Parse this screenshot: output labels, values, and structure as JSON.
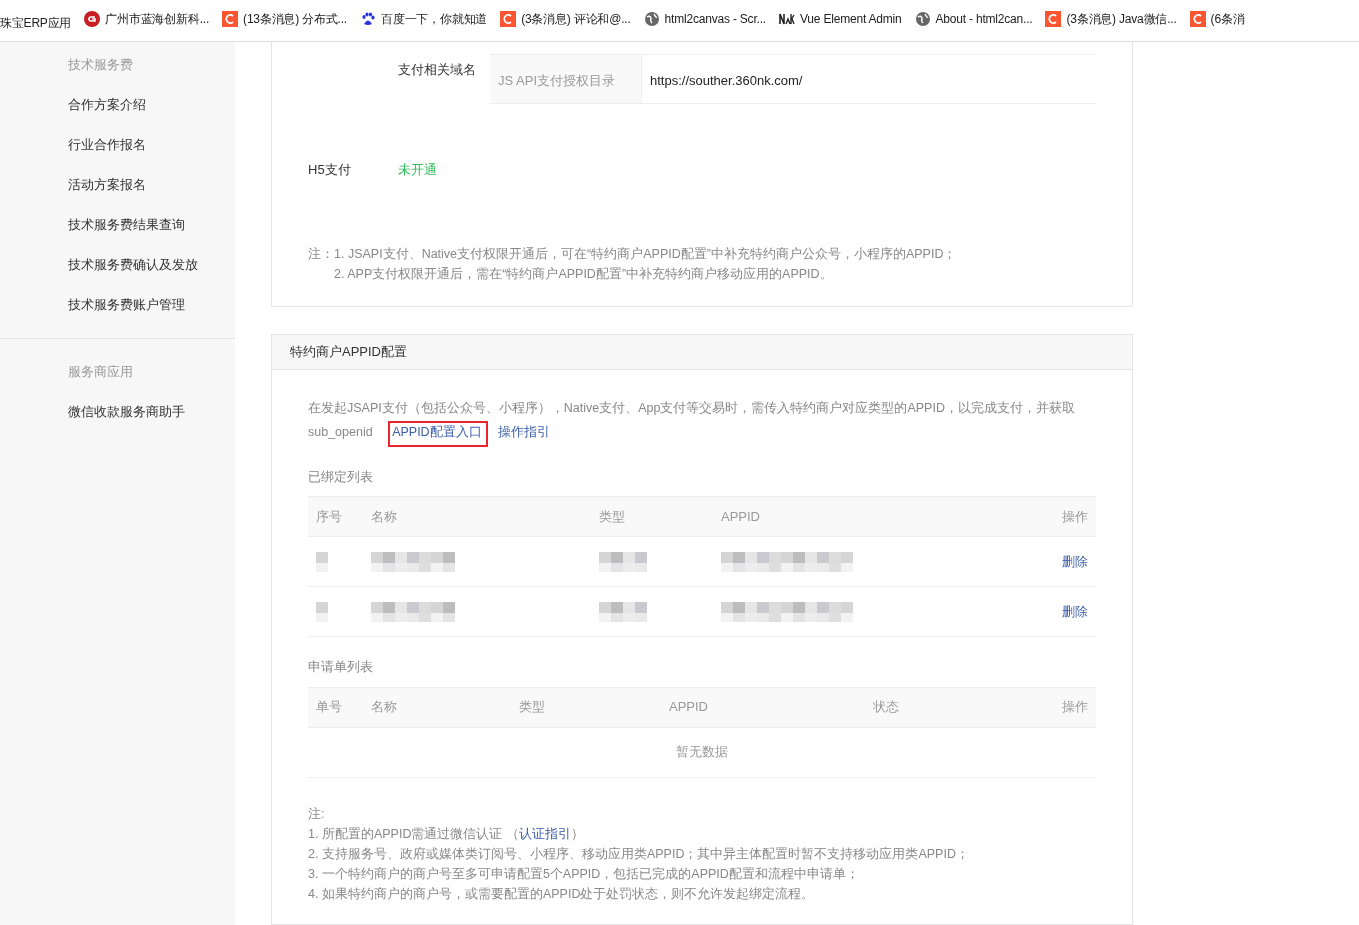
{
  "bookmarks": [
    {
      "kind": "plain",
      "label": "珠宝ERP应用"
    },
    {
      "kind": "gitee",
      "label": "广州市蓝海创新科..."
    },
    {
      "kind": "csdn",
      "label": "(13条消息) 分布式..."
    },
    {
      "kind": "baidu",
      "label": "百度一下，你就知道"
    },
    {
      "kind": "csdn",
      "label": "(3条消息) 评论和@..."
    },
    {
      "kind": "globe",
      "label": "html2canvas - Scr..."
    },
    {
      "kind": "nk",
      "label": "Vue Element Admin"
    },
    {
      "kind": "globe",
      "label": "About - html2can..."
    },
    {
      "kind": "csdn",
      "label": "(3条消息) Java微信..."
    },
    {
      "kind": "csdn",
      "label": "(6条消"
    }
  ],
  "sidebar": {
    "groups": [
      {
        "title": "技术服务费",
        "items": [
          "合作方案介绍",
          "行业合作报名",
          "活动方案报名",
          "技术服务费结果查询",
          "技术服务费确认及发放",
          "技术服务费账户管理"
        ]
      },
      {
        "title": "服务商应用",
        "items": [
          "微信收款服务商助手"
        ]
      }
    ]
  },
  "payment_card": {
    "domain_label": "支付相关域名",
    "domain_table": {
      "key": "JS API支付授权目录",
      "value": "https://souther.360nk.com/"
    },
    "h5": {
      "label": "H5支付",
      "status": "未开通"
    },
    "note_prefix": "注：",
    "notes": [
      "1. JSAPI支付、Native支付权限开通后，可在“特约商户APPID配置”中补充特约商户公众号，小程序的APPID；",
      "2. APP支付权限开通后，需在“特约商户APPID配置”中补充特约商户移动应用的APPID。"
    ]
  },
  "appid_card": {
    "title": "特约商户APPID配置",
    "intro": "在发起JSAPI支付（包括公众号、小程序），Native支付、App支付等交易时，需传入特约商户对应类型的APPID，以完成支付，并获取sub_openid",
    "links": [
      {
        "label": "APPID配置入口",
        "highlighted": true
      },
      {
        "label": "操作指引",
        "highlighted": false
      }
    ],
    "bound_title": "已绑定列表",
    "bound_table": {
      "columns": [
        "序号",
        "名称",
        "类型",
        "APPID",
        "操作"
      ],
      "rows": [
        {
          "action": "删除"
        },
        {
          "action": "删除"
        }
      ]
    },
    "apply_title": "申请单列表",
    "apply_table": {
      "columns": [
        "单号",
        "名称",
        "类型",
        "APPID",
        "状态",
        "操作"
      ],
      "empty": "暂无数据"
    },
    "notes_title": "注:",
    "notes": [
      {
        "text": "1. 所配置的APPID需通过微信认证 （",
        "link": "认证指引",
        "after": "）"
      },
      {
        "text": "2. 支持服务号、政府或媒体类订阅号、小程序、移动应用类APPID；其中异主体配置时暂不支持移动应用类APPID；"
      },
      {
        "text": "3. 一个特约商户的商户号至多可申请配置5个APPID，包括已完成的APPID配置和流程中申请单；"
      },
      {
        "text": "4. 如果特约商户的商户号，或需要配置的APPID处于处罚状态，则不允许发起绑定流程。"
      }
    ]
  }
}
